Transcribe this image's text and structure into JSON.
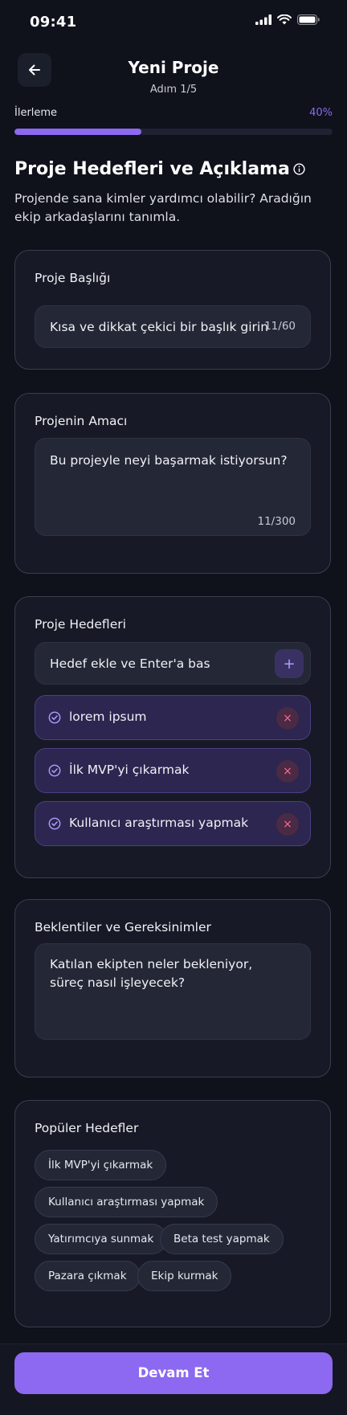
{
  "status_bar": {
    "time": "09:41"
  },
  "header": {
    "title": "Yeni Proje",
    "step": "Adım 1/5"
  },
  "progress": {
    "label": "İlerleme",
    "percent_text": "40%",
    "value": 0.4
  },
  "section": {
    "title": "Proje Hedefleri ve Açıklama",
    "description": "Projende sana kimler yardımcı olabilir? Aradığın ekip arkadaşlarını tanımla."
  },
  "project_title": {
    "label": "Proje Başlığı",
    "placeholder": "Kısa ve dikkat çekici bir başlık girin",
    "counter": "11/60"
  },
  "project_purpose": {
    "label": "Projenin Amacı",
    "placeholder": "Bu projeyle neyi başarmak istiyorsun?",
    "counter": "11/300"
  },
  "goals": {
    "label": "Proje Hedefleri",
    "input_placeholder": "Hedef ekle ve Enter'a bas",
    "add_symbol": "+",
    "remove_symbol": "×",
    "items": [
      {
        "text": "lorem ipsum"
      },
      {
        "text": "İlk MVP'yi çıkarmak"
      },
      {
        "text": "Kullanıcı araştırması yapmak"
      }
    ]
  },
  "expectations": {
    "label": "Beklentiler ve Gereksinimler",
    "placeholder": "Katılan ekipten neler bekleniyor, süreç nasıl işleyecek?"
  },
  "popular_goals": {
    "label": "Popüler Hedefler",
    "chips": [
      "İlk MVP'yi çıkarmak",
      "Kullanıcı araştırması yapmak",
      "Yatırımcıya sunmak",
      "Beta test yapmak",
      "Pazara çıkmak",
      "Ekip kurmak"
    ]
  },
  "footer": {
    "continue_label": "Devam Et"
  },
  "colors": {
    "accent": "#8c69f0",
    "background": "#0f111b",
    "card": "#171a26"
  }
}
